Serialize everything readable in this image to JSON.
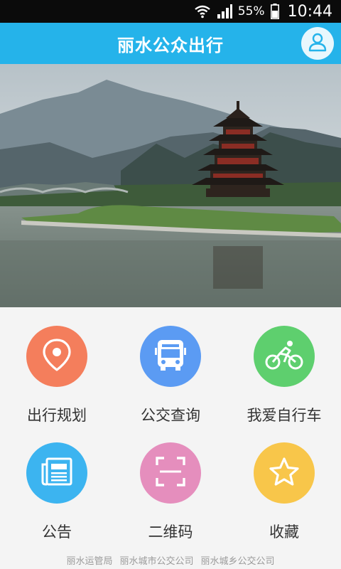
{
  "status_bar": {
    "battery": "55%",
    "time": "10:44"
  },
  "app": {
    "title": "丽水公众出行"
  },
  "menu": [
    {
      "label": "出行规划",
      "icon": "location-pin-icon",
      "color": "#f47e5c"
    },
    {
      "label": "公交查询",
      "icon": "bus-icon",
      "color": "#5b9bf3"
    },
    {
      "label": "我爱自行车",
      "icon": "bicycle-icon",
      "color": "#5ecf6e"
    },
    {
      "label": "公告",
      "icon": "newspaper-icon",
      "color": "#3cb4f0"
    },
    {
      "label": "二维码",
      "icon": "qr-scan-icon",
      "color": "#e58ebd"
    },
    {
      "label": "收藏",
      "icon": "star-icon",
      "color": "#f8c64a"
    }
  ],
  "footer": {
    "links": [
      "丽水运管局",
      "丽水城市公交公司",
      "丽水城乡公交公司"
    ]
  }
}
